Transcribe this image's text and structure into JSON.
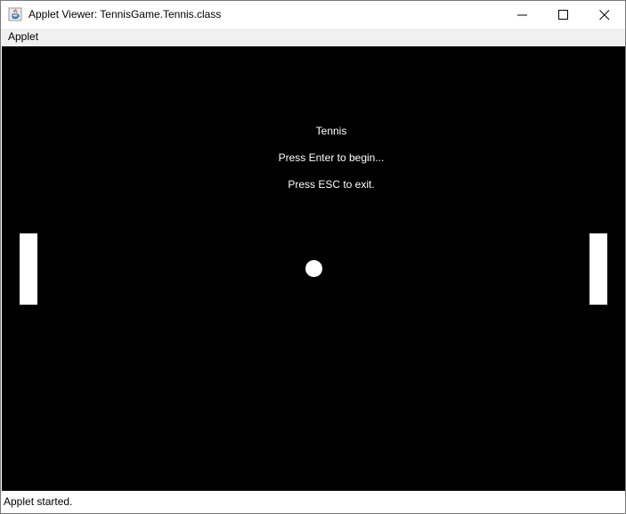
{
  "window": {
    "title": "Applet Viewer: TennisGame.Tennis.class",
    "app_icon": "java-icon",
    "controls": {
      "minimize_icon": "minimize-icon",
      "maximize_icon": "maximize-icon",
      "close_icon": "close-icon"
    }
  },
  "menubar": {
    "items": [
      {
        "label": "Applet"
      }
    ]
  },
  "game": {
    "title": "Tennis",
    "start_prompt": "Press Enter to begin...",
    "exit_prompt": "Press ESC to exit.",
    "background_color": "#000000",
    "foreground_color": "#ffffff"
  },
  "statusbar": {
    "text": "Applet started."
  }
}
